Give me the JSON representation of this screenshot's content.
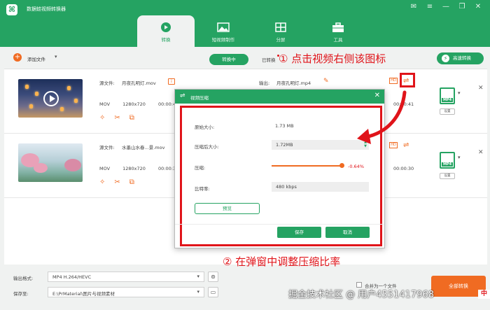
{
  "app": {
    "title": "数据蛙视频转换器",
    "logo_glyph": "⌘"
  },
  "window_controls": [
    "✉",
    "≡",
    "—",
    "❐",
    "✕"
  ],
  "tabs": [
    {
      "label": "转换",
      "icon": "convert-icon",
      "active": true
    },
    {
      "label": "短视频制作",
      "icon": "image-icon",
      "active": false
    },
    {
      "label": "分屏",
      "icon": "split-screen-icon",
      "active": false
    },
    {
      "label": "工具",
      "icon": "toolbox-icon",
      "active": false
    }
  ],
  "toolbar": {
    "add_label": "添加文件",
    "add_glyph": "+",
    "caret": "▾",
    "converting_label": "转换中",
    "converted_label": "已转换",
    "speed_label": "高速转换",
    "speed_glyph": "⚡"
  },
  "files": [
    {
      "src_label": "源文件:",
      "src_name": "月夜孔明灯.mov",
      "format": "MOV",
      "resolution": "1280x720",
      "duration": "00:00:41",
      "out_label": "输出:",
      "out_name": "月夜孔明灯.mp4",
      "out_time": "00:00:41",
      "out_format": "MP4",
      "settings_label": "设置"
    },
    {
      "src_label": "源文件:",
      "src_name": "水墨山水春...景.mov",
      "format": "MOV",
      "resolution": "1280x720",
      "duration": "00:00:30",
      "out_label": "输出:",
      "out_name": "",
      "out_time": "00:00:30",
      "out_format": "MP4",
      "settings_label": "设置"
    }
  ],
  "row_icons": {
    "info": "i",
    "edit": "✎",
    "hd": "HD",
    "compress": "⇌",
    "close": "✕",
    "tools": [
      "✧",
      "✂",
      "⧉"
    ]
  },
  "dialog": {
    "title": "视频压缩",
    "close_glyph": "✕",
    "icon_glyph": "⇌",
    "original_size_label": "原始大小:",
    "original_size_value": "1.73 MB",
    "compressed_size_label": "压缩后大小:",
    "compressed_size_value": "1.72MB",
    "compression_label": "压缩:",
    "compression_value": "-0.64%",
    "compression_fraction": 0.96,
    "bitrate_label": "比特率:",
    "bitrate_value": "480 kbps",
    "preview_label": "预览",
    "save_label": "保存",
    "cancel_label": "取消"
  },
  "bottom": {
    "output_format_label": "输出格式:",
    "output_format_value": "MP4 H.264/HEVC",
    "save_to_label": "保存至:",
    "save_to_value": "E:\\PrMaterial\\图片与视频素材",
    "merge_label": "合并为一个文件",
    "convert_all_label": "全部转换"
  },
  "annotations": {
    "step1": "① 点击视频右侧该图标",
    "step2": "② 在弹窗中调整压缩比率"
  },
  "watermark": "掘金技术社区 @ 用户4551417968",
  "colors": {
    "brand_green": "#25a362",
    "accent_orange": "#f06b22",
    "annotation_red": "#e0141a"
  }
}
